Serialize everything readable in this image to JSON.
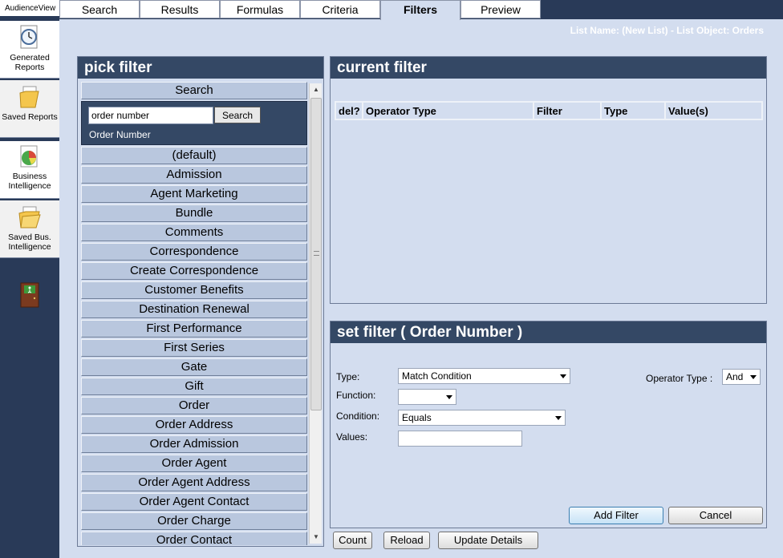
{
  "app": {
    "title": "AudienceView"
  },
  "nav": [
    {
      "label": "Generated Reports",
      "icon": "clock-document-icon"
    },
    {
      "label": "Saved Reports",
      "icon": "folder-icon"
    },
    {
      "label": "Business Intelligence",
      "icon": "pie-chart-icon"
    },
    {
      "label": "Saved Bus. Intelligence",
      "icon": "open-folder-icon"
    }
  ],
  "nav_labels": {
    "generated_1": "Generated",
    "generated_2": "Reports",
    "saved_1": "Saved Reports",
    "bi_1": "Business",
    "bi_2": "Intelligence",
    "sbi_1": "Saved Bus.",
    "sbi_2": "Intelligence"
  },
  "tabs": {
    "search": "Search",
    "results": "Results",
    "formulas": "Formulas",
    "criteria": "Criteria",
    "filters": "Filters",
    "preview": "Preview",
    "active": "Filters"
  },
  "list_name": "List Name: (New List) - List Object: Orders",
  "pick_filter": {
    "title": "pick filter",
    "search_header": "Search",
    "search_value": "order number",
    "search_button": "Search",
    "search_result": "Order Number",
    "categories": [
      "(default)",
      "Admission",
      "Agent Marketing",
      "Bundle",
      "Comments",
      "Correspondence",
      "Create Correspondence",
      "Customer Benefits",
      "Destination Renewal",
      "First Performance",
      "First Series",
      "Gate",
      "Gift",
      "Order",
      "Order Address",
      "Order Admission",
      "Order Agent",
      "Order Agent Address",
      "Order Agent Contact",
      "Order Charge",
      "Order Contact"
    ]
  },
  "current_filter": {
    "title": "current filter",
    "columns": {
      "del": "del?",
      "operator": "Operator Type",
      "filter": "Filter",
      "type": "Type",
      "values": "Value(s)"
    }
  },
  "set_filter": {
    "title": "set filter ( Order Number )",
    "type_label": "Type:",
    "type_value": "Match Condition",
    "function_label": "Function:",
    "function_value": "",
    "condition_label": "Condition:",
    "condition_value": "Equals",
    "values_label": "Values:",
    "values_value": "",
    "operator_label": "Operator Type :",
    "operator_value": "And",
    "add_button": "Add Filter",
    "cancel_button": "Cancel"
  },
  "bottom_buttons": {
    "count": "Count",
    "reload": "Reload",
    "update": "Update Details"
  },
  "colors": {
    "nav_bg": "#293a58",
    "panel_header": "#344865",
    "page_bg": "#d3ddef",
    "category_button": "#b9c7de"
  }
}
